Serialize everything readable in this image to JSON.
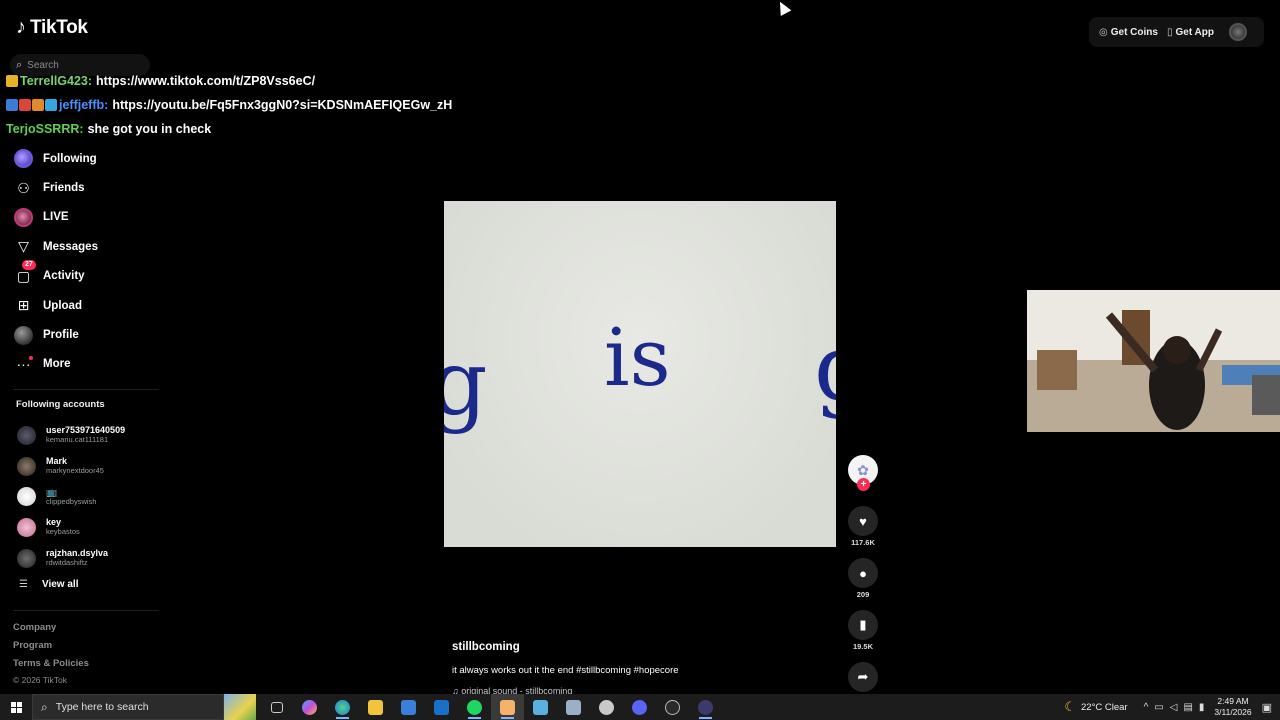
{
  "app": {
    "logo_glyph": "♪",
    "name": "TikTok"
  },
  "search": {
    "placeholder": "Search"
  },
  "nav": {
    "following": "Following",
    "friends": "Friends",
    "live": "LIVE",
    "messages": "Messages",
    "activity": "Activity",
    "activity_badge": "27",
    "upload": "Upload",
    "profile": "Profile",
    "more": "More"
  },
  "following_accounts": {
    "title": "Following accounts",
    "items": [
      {
        "name": "user753971640509",
        "handle": "kemariu.cat111181"
      },
      {
        "name": "Mark",
        "handle": "markynextdoor45"
      },
      {
        "name": "📺",
        "handle": "clippedbyswish"
      },
      {
        "name": "key",
        "handle": "keybastos"
      },
      {
        "name": "rajzhan.dsylva",
        "handle": "rdwitdashiftz"
      }
    ],
    "view_all": "View all"
  },
  "footer": {
    "links": [
      "Company",
      "Program",
      "Terms & Policies"
    ],
    "copyright": "© 2026 TikTok"
  },
  "chat": [
    {
      "user": "TerrellG423",
      "sep": ":",
      "message": "https://www.tiktok.com/t/ZP8Vss6eC/"
    },
    {
      "user": "jeffjeffb",
      "sep": ":",
      "message": "https://youtu.be/Fq5Fnx3ggN0?si=KDSNmAEFIQEGw_zH"
    },
    {
      "user": "TerjoSSRRR",
      "sep": ":",
      "message": "she got you in check"
    }
  ],
  "topbar": {
    "get_coins": "Get Coins",
    "get_app": "Get App"
  },
  "video": {
    "handwritten_text": "is"
  },
  "actions": {
    "likes": "117.6K",
    "comments": "209",
    "saves": "19.5K"
  },
  "caption": {
    "username": "stillbcoming",
    "text": "it always works out it the end #stillbcoming #hopecore",
    "sound": "original sound - stillbcoming"
  },
  "taskbar": {
    "search_placeholder": "Type here to search",
    "weather": "22°C  Clear",
    "time": "2:49 AM",
    "date": "3/11/2026"
  },
  "colors": {
    "accent": "#fe2c55",
    "chat_user1": "#7cd36a",
    "chat_user2": "#4d8fff",
    "chat_user3": "#5ed04c",
    "ink": "#1b2a8a"
  }
}
